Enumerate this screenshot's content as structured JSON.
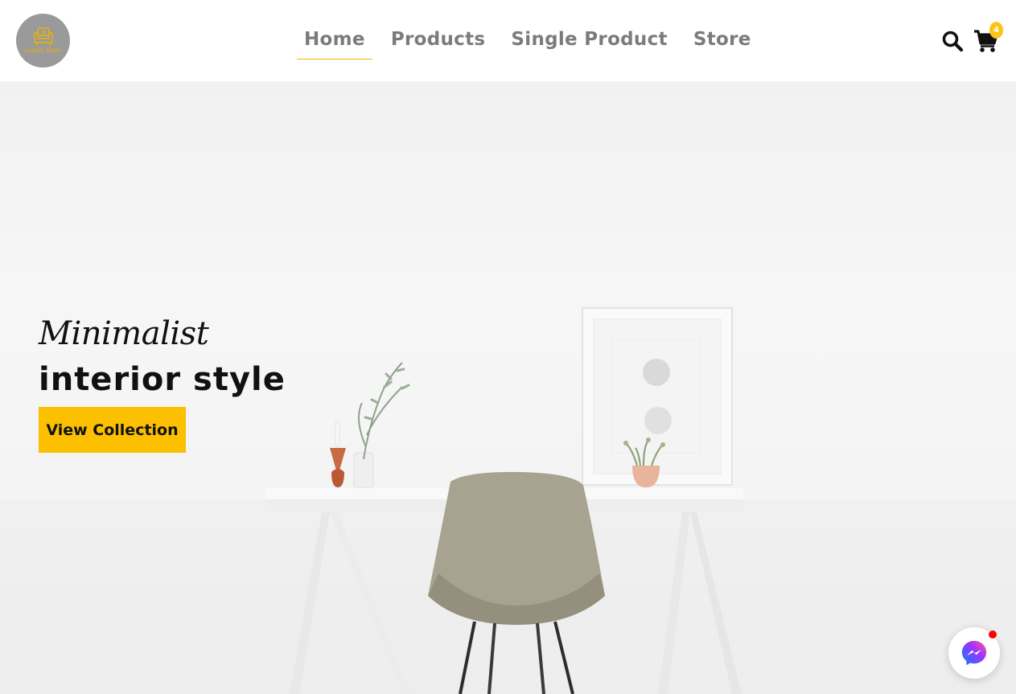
{
  "brand": {
    "logo_text": "Comfy Sloth"
  },
  "nav": {
    "items": [
      {
        "label": "Home",
        "active": true
      },
      {
        "label": "Products",
        "active": false
      },
      {
        "label": "Single Product",
        "active": false
      },
      {
        "label": "Store",
        "active": false
      }
    ]
  },
  "header_actions": {
    "search_icon": "search-icon",
    "cart_icon": "cart-icon",
    "cart_count": "4"
  },
  "hero": {
    "subtitle": "Minimalist",
    "title": "interior style",
    "button_label": "View Collection"
  },
  "colors": {
    "accent": "#fcc000",
    "nav_text": "#7b7b7b",
    "logo_bg": "#9a9a9a",
    "badge": "#fcc419"
  },
  "messenger": {
    "icon": "messenger-icon",
    "has_notification": true
  }
}
